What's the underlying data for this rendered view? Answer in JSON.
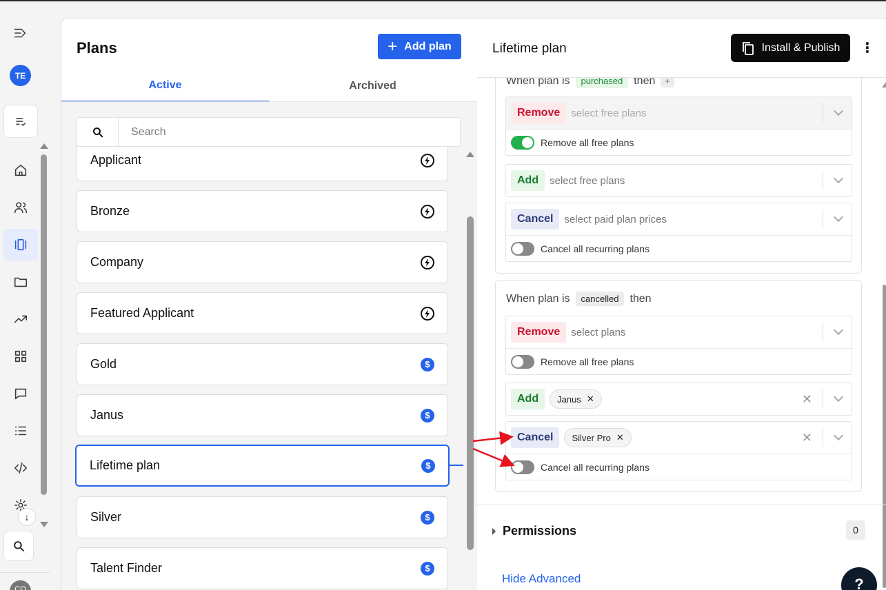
{
  "rail": {
    "avatar_initials": "TE",
    "bottom_avatar_initials": "CO"
  },
  "plans_panel": {
    "title": "Plans",
    "add_plan_label": "Add plan",
    "tabs": [
      {
        "label": "Active",
        "active": true
      },
      {
        "label": "Archived",
        "active": false
      }
    ],
    "search_placeholder": "Search",
    "items": [
      {
        "name": "Applicant",
        "type": "free"
      },
      {
        "name": "Bronze",
        "type": "free"
      },
      {
        "name": "Company",
        "type": "free"
      },
      {
        "name": "Featured Applicant",
        "type": "free"
      },
      {
        "name": "Gold",
        "type": "paid"
      },
      {
        "name": "Janus",
        "type": "paid"
      },
      {
        "name": "Lifetime plan",
        "type": "paid",
        "selected": true
      },
      {
        "name": "Silver",
        "type": "paid"
      },
      {
        "name": "Talent Finder",
        "type": "paid"
      }
    ]
  },
  "detail": {
    "title": "Lifetime plan",
    "publish_label": "Install & Publish",
    "purchased_card": {
      "when_prefix": "When plan is",
      "event": "purchased",
      "then": "then",
      "plus": "+",
      "remove_tag": "Remove",
      "remove_placeholder": "select free plans",
      "remove_toggle_label": "Remove all free plans",
      "remove_toggle_on": true,
      "add_tag": "Add",
      "add_placeholder": "select free plans",
      "cancel_tag": "Cancel",
      "cancel_placeholder": "select paid plan prices",
      "cancel_toggle_label": "Cancel all recurring plans",
      "cancel_toggle_on": false
    },
    "cancelled_card": {
      "when_prefix": "When plan is",
      "event": "cancelled",
      "then": "then",
      "remove_tag": "Remove",
      "remove_placeholder": "select plans",
      "remove_toggle_label": "Remove all free plans",
      "add_tag": "Add",
      "add_selected": "Janus",
      "cancel_tag": "Cancel",
      "cancel_selected": "Silver Pro",
      "cancel_toggle_label": "Cancel all recurring plans"
    },
    "permissions_label": "Permissions",
    "permissions_count": "0",
    "hide_advanced_label": "Hide Advanced",
    "help_label": "?"
  },
  "colors": {
    "accent": "#2563eb",
    "annotation_arrow": "#e8141e"
  }
}
